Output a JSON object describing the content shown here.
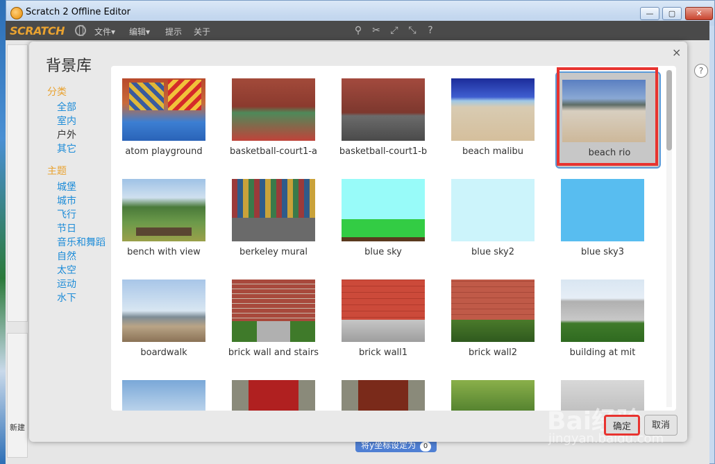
{
  "window": {
    "title": "Scratch 2 Offline Editor",
    "min": "—",
    "max": "▢",
    "close": "✕"
  },
  "menubar": {
    "logo": "SCRATCH",
    "items": [
      "文件▾",
      "编辑▾",
      "提示",
      "关于"
    ]
  },
  "toolbar_icons": [
    "stamp-icon",
    "cut-icon",
    "grow-icon",
    "shrink-icon",
    "help-icon"
  ],
  "dialog": {
    "title": "背景库",
    "close": "×",
    "category_heading": "分类",
    "categories": [
      "全部",
      "室内",
      "户外",
      "其它"
    ],
    "selected_category": "户外",
    "theme_heading": "主题",
    "themes": [
      "城堡",
      "城市",
      "飞行",
      "节日",
      "音乐和舞蹈",
      "自然",
      "太空",
      "运动",
      "水下"
    ],
    "items": [
      {
        "label": "atom playground"
      },
      {
        "label": "basketball-court1-a"
      },
      {
        "label": "basketball-court1-b"
      },
      {
        "label": "beach malibu"
      },
      {
        "label": "beach rio",
        "selected": true
      },
      {
        "label": "bench with view"
      },
      {
        "label": "berkeley mural"
      },
      {
        "label": "blue sky"
      },
      {
        "label": "blue sky2"
      },
      {
        "label": "blue sky3"
      },
      {
        "label": "boardwalk"
      },
      {
        "label": "brick wall and stairs"
      },
      {
        "label": "brick wall1"
      },
      {
        "label": "brick wall2"
      },
      {
        "label": "building at mit"
      },
      {
        "label": ""
      },
      {
        "label": ""
      },
      {
        "label": ""
      },
      {
        "label": ""
      },
      {
        "label": ""
      }
    ],
    "ok": "确定",
    "cancel": "取消"
  },
  "editor": {
    "new_label": "新建",
    "block_text": "将y坐标设定为",
    "block_value": "0",
    "help": "?"
  },
  "watermark": {
    "main": "Bai经验",
    "sub": "jingyan.baidu.com"
  },
  "colors": {
    "accent": "#e8332f",
    "link": "#1d8cd8",
    "heading": "#e9a230",
    "selected_border": "#5a9ad8"
  }
}
